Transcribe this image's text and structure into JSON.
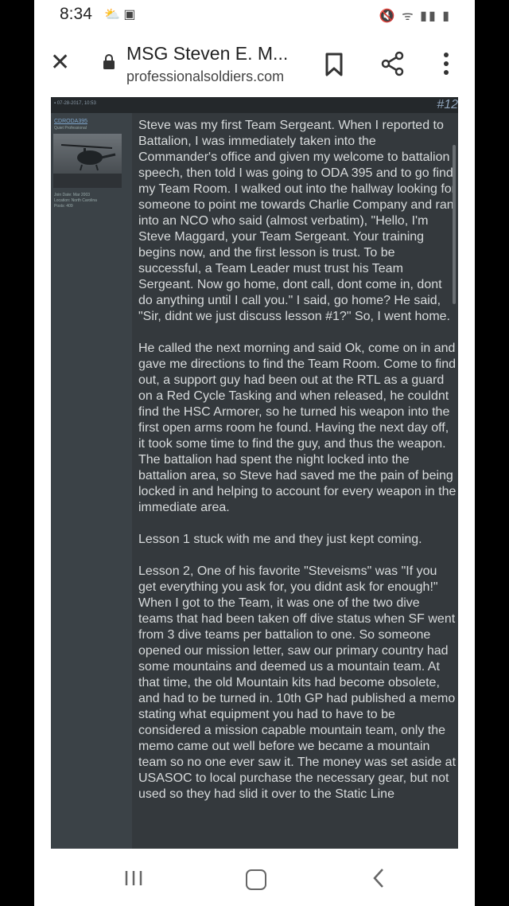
{
  "status_bar": {
    "time": "8:34",
    "left_icons": "⛅ ▣",
    "right_icons": "🔇 ᯤ ▮▮ ▮"
  },
  "browser": {
    "title": "MSG Steven E. M...",
    "url": "professionalsoldiers.com"
  },
  "post": {
    "header_meta": "▪ 07-28-2017, 10:53",
    "number": "#12",
    "user": {
      "name": "CDRODA395",
      "title": "Quiet Professional",
      "join_date": "Join Date: Mar 2003",
      "location": "Location: North Carolina",
      "posts": "Posts: 409"
    },
    "paragraphs": [
      "Steve was my first Team Sergeant. When I reported to Battalion, I was immediately taken into the Commander's office and given my welcome to battalion speech, then told I was going to ODA 395 and to go find my Team Room. I walked out into the hallway looking for someone to point me towards Charlie Company and ran into an NCO who said (almost verbatim), \"Hello, I'm Steve Maggard, your Team Sergeant. Your training begins now, and the first lesson is trust. To be successful, a Team Leader must trust his Team Sergeant. Now go home, dont call, dont come in, dont do anything until I call you.\" I said, go home? He said, \"Sir, didnt we just discuss lesson #1?\" So, I went home.",
      "He called the next morning and said Ok, come on in and gave me directions to find the Team Room. Come to find out, a support guy had been out at the RTL as a guard on a Red Cycle Tasking and when released, he couldnt find the HSC Armorer, so he turned his weapon into the first open arms room he found. Having the next day off, it took some time to find the guy, and thus the weapon. The battalion had spent the night locked into the battalion area, so Steve had saved me the pain of being locked in and helping to account for every weapon in the immediate area.",
      "Lesson 1 stuck with me and they just kept coming.",
      "Lesson 2, One of his favorite \"Steveisms\" was \"If you get everything you ask for, you didnt ask for enough!\" When I got to the Team, it was one of the two dive teams that had been taken off dive status when SF went from 3 dive teams per battalion to one. So someone opened our mission letter, saw our primary country had some mountains and deemed us a mountain team. At that time, the old Mountain kits had become obsolete, and had to be turned in. 10th GP had published a memo stating what equipment you had to have to be considered a mission capable mountain team, only the memo came out well before we became a mountain team so no one ever saw it. The money was set aside at USASOC to local purchase the necessary gear, but not used so they had slid it over to the Static Line"
    ]
  }
}
